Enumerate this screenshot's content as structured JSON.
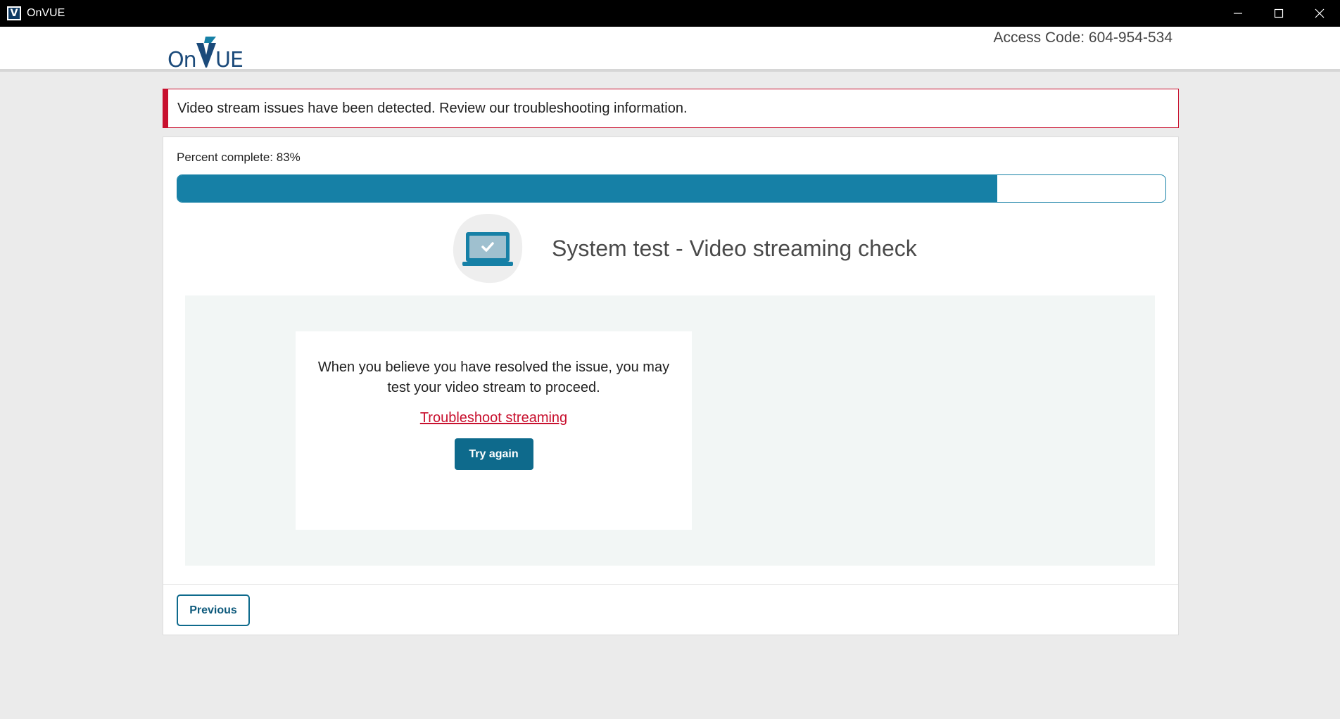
{
  "window": {
    "title": "OnVUE",
    "icon_letter": "V"
  },
  "header": {
    "logo_on": "On",
    "logo_ue": "UE",
    "access_code": "Access Code: 604-954-534"
  },
  "alert": {
    "message": "Video stream issues have been detected. Review our troubleshooting information.",
    "color": "#c8102e"
  },
  "progress": {
    "label": "Percent complete: 83%",
    "percent": 83,
    "color": "#1680a6"
  },
  "step": {
    "title": "System test - Video streaming check",
    "icon": "laptop-check-icon"
  },
  "panel": {
    "message": "When you believe you have resolved the issue, you may test your video stream to proceed.",
    "link_label": "Troubleshoot streaming",
    "button_label": "Try again"
  },
  "footer": {
    "previous_label": "Previous"
  }
}
